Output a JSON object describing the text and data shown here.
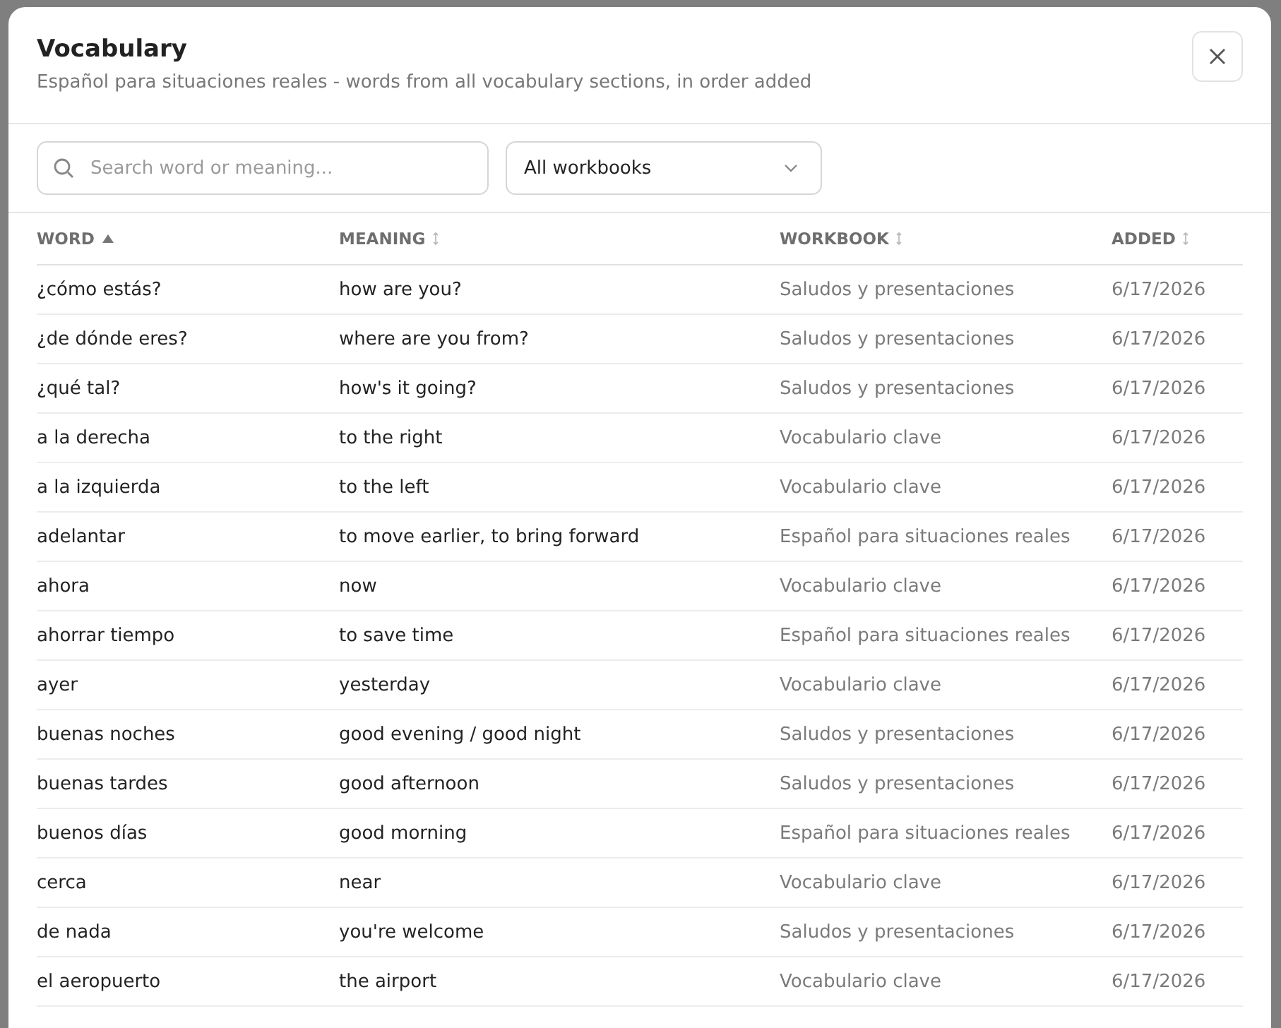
{
  "dialog": {
    "title": "Vocabulary",
    "subtitle": "Español para situaciones reales - words from all vocabulary sections, in order added"
  },
  "search": {
    "placeholder": "Search word or meaning..."
  },
  "workbook_filter": {
    "value": "All workbooks"
  },
  "table": {
    "columns": [
      {
        "label": "WORD",
        "sorted": true
      },
      {
        "label": "MEANING",
        "sorted": false
      },
      {
        "label": "WORKBOOK",
        "sorted": false
      },
      {
        "label": "ADDED",
        "sorted": false
      }
    ],
    "rows": [
      [
        "¿cómo estás?",
        "how are you?",
        "Saludos y presentaciones",
        "6/17/2026"
      ],
      [
        "¿de dónde eres?",
        "where are you from?",
        "Saludos y presentaciones",
        "6/17/2026"
      ],
      [
        "¿qué tal?",
        "how's it going?",
        "Saludos y presentaciones",
        "6/17/2026"
      ],
      [
        "a la derecha",
        "to the right",
        "Vocabulario clave",
        "6/17/2026"
      ],
      [
        "a la izquierda",
        "to the left",
        "Vocabulario clave",
        "6/17/2026"
      ],
      [
        "adelantar",
        "to move earlier, to bring forward",
        "Español para situaciones reales",
        "6/17/2026"
      ],
      [
        "ahora",
        "now",
        "Vocabulario clave",
        "6/17/2026"
      ],
      [
        "ahorrar tiempo",
        "to save time",
        "Español para situaciones reales",
        "6/17/2026"
      ],
      [
        "ayer",
        "yesterday",
        "Vocabulario clave",
        "6/17/2026"
      ],
      [
        "buenas noches",
        "good evening / good night",
        "Saludos y presentaciones",
        "6/17/2026"
      ],
      [
        "buenas tardes",
        "good afternoon",
        "Saludos y presentaciones",
        "6/17/2026"
      ],
      [
        "buenos días",
        "good morning",
        "Español para situaciones reales",
        "6/17/2026"
      ],
      [
        "cerca",
        "near",
        "Vocabulario clave",
        "6/17/2026"
      ],
      [
        "de nada",
        "you're welcome",
        "Saludos y presentaciones",
        "6/17/2026"
      ],
      [
        "el aeropuerto",
        "the airport",
        "Vocabulario clave",
        "6/17/2026"
      ]
    ]
  }
}
